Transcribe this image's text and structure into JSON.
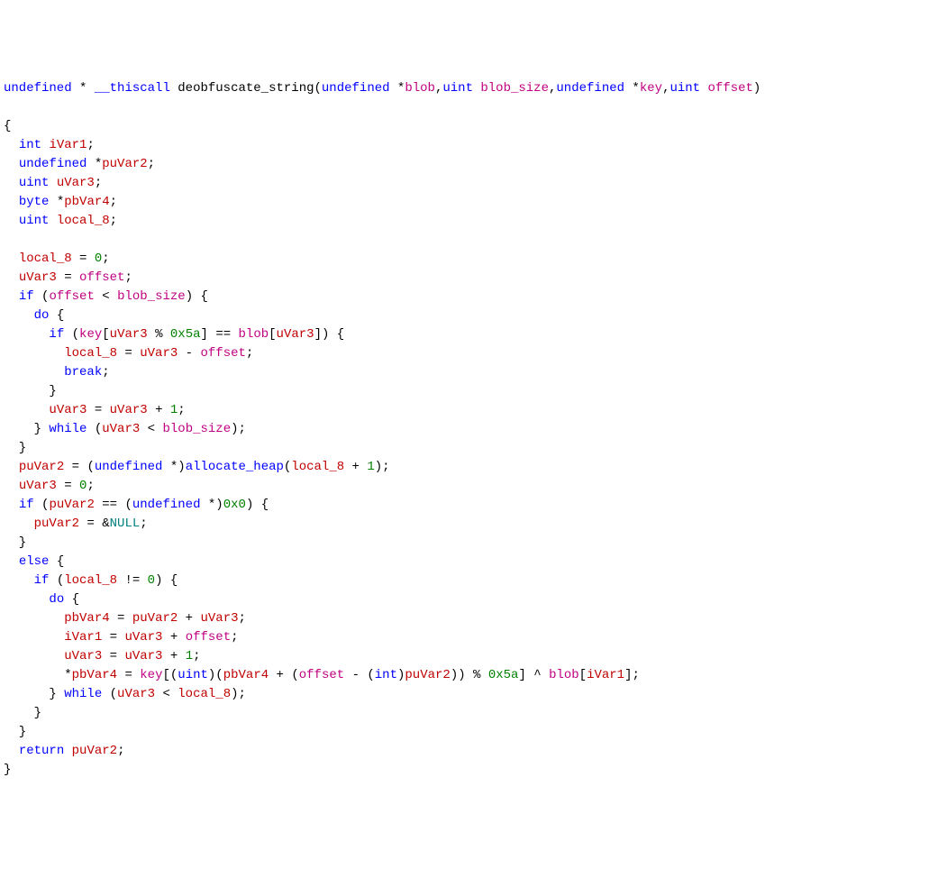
{
  "t": {
    "undef": "undefined",
    "int": "int",
    "uint": "uint",
    "byte": "byte"
  },
  "k": {
    "thiscall": "__thiscall",
    "if": "if",
    "do": "do",
    "while": "while",
    "break": "break",
    "else": "else",
    "return": "return"
  },
  "fn": {
    "name": "deobfuscate_string",
    "alloc": "allocate_heap"
  },
  "p": {
    "blob": "blob",
    "blob_size": "blob_size",
    "key": "key",
    "offset": "offset"
  },
  "v": {
    "iVar1": "iVar1",
    "puVar2": "puVar2",
    "uVar3": "uVar3",
    "pbVar4": "pbVar4",
    "local_8": "local_8"
  },
  "n": {
    "zero": "0",
    "one": "1",
    "hex5a": "0x5a",
    "hex0": "0x0"
  },
  "c": {
    "NULL": "NULL"
  }
}
